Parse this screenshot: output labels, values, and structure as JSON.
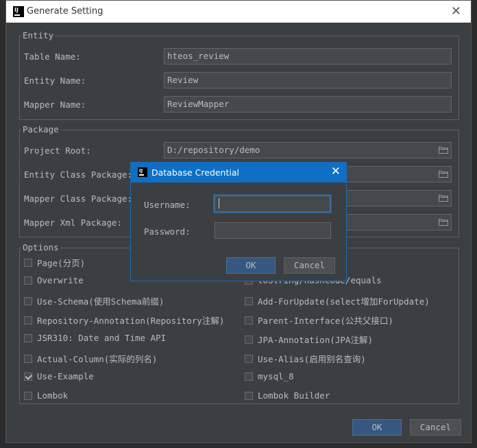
{
  "window": {
    "title": "Generate Setting"
  },
  "entity": {
    "group_label": "Entity",
    "table_name_label": "Table Name:",
    "table_name_value": "hteos_review",
    "entity_name_label": "Entity Name:",
    "entity_name_value": "Review",
    "mapper_name_label": "Mapper Name:",
    "mapper_name_value": "ReviewMapper"
  },
  "package": {
    "group_label": "Package",
    "project_root_label": "Project Root:",
    "project_root_value": "D:/repository/demo",
    "entity_class_label": "Entity Class Package:",
    "mapper_class_label": "Mapper Class Package:",
    "mapper_xml_label": "Mapper Xml Package:"
  },
  "options": {
    "group_label": "Options",
    "left": [
      {
        "label": "Page(分页)",
        "checked": false
      },
      {
        "label": "Overwrite",
        "checked": false
      },
      {
        "label": "Use-Schema(使用Schema前缀)",
        "checked": false
      },
      {
        "label": "Repository-Annotation(Repository注解)",
        "checked": false
      },
      {
        "label": "JSR310: Date and Time API",
        "checked": false
      },
      {
        "label": "Actual-Column(实际的列名)",
        "checked": false
      },
      {
        "label": "Use-Example",
        "checked": true
      },
      {
        "label": "Lombok",
        "checked": false
      }
    ],
    "right": [
      {
        "label": "toString/hashCode/equals",
        "checked": false
      },
      {
        "label": "Add-ForUpdate(select增加ForUpdate)",
        "checked": false
      },
      {
        "label": "Parent-Interface(公共父接口)",
        "checked": false
      },
      {
        "label": "JPA-Annotation(JPA注解)",
        "checked": false
      },
      {
        "label": "Use-Alias(启用别名查询)",
        "checked": false
      },
      {
        "label": "mysql_8",
        "checked": false
      },
      {
        "label": "Lombok Builder",
        "checked": false
      }
    ]
  },
  "footer": {
    "ok_label": "OK",
    "cancel_label": "Cancel"
  },
  "modal": {
    "title": "Database Credential",
    "username_label": "Username:",
    "username_value": "",
    "password_label": "Password:",
    "ok_label": "OK",
    "cancel_label": "Cancel"
  },
  "colors": {
    "accent": "#0e6fc4",
    "background": "#3c3f41",
    "primary_button": "#365880"
  }
}
